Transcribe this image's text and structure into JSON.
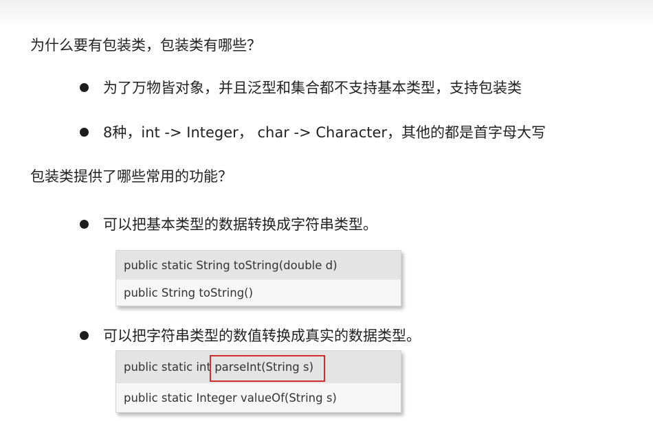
{
  "slide": {
    "question1": "为什么要有包装类，包装类有哪些？",
    "bullets1": [
      "为了万物皆对象，并且泛型和集合都不支持基本类型，支持包装类",
      "8种，int -> Integer， char -> Character，其他的都是首字母大写"
    ],
    "question2": "包装类提供了哪些常用的功能？",
    "bullet_tostring": "可以把基本类型的数据转换成字符串类型。",
    "tostring_methods": [
      "public static String toString(double d)",
      "public String toString()"
    ],
    "bullet_parse": "可以把字符串类型的数值转换成真实的数据类型。",
    "parse_methods": [
      "public static int parseInt(String s)",
      "public static Integer valueOf(String s)"
    ],
    "highlight_color": "#d22b2b"
  }
}
